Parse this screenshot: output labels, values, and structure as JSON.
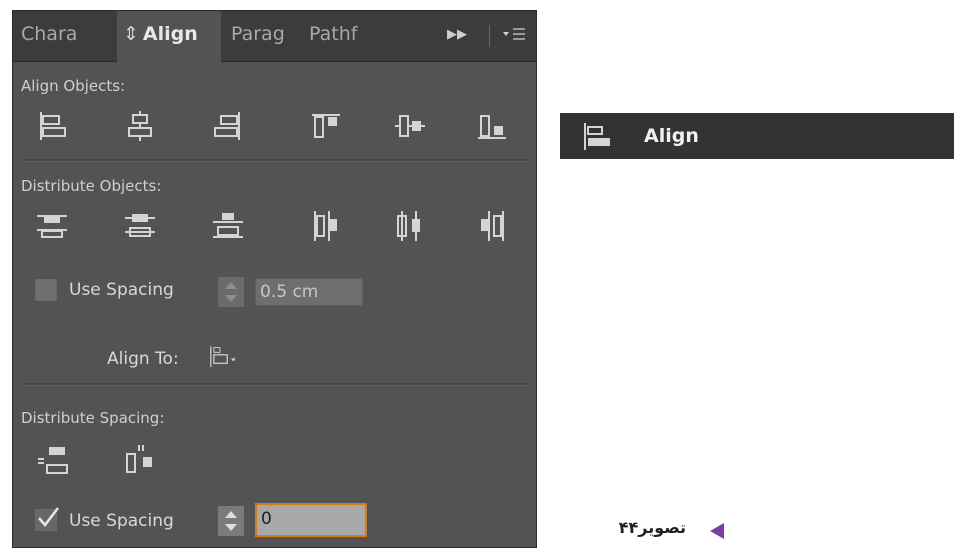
{
  "tabs": [
    {
      "label": "Chara"
    },
    {
      "label": "Align",
      "prefix": "⇕"
    },
    {
      "label": "Parag"
    },
    {
      "label": "Pathf"
    }
  ],
  "icons": {
    "more_tabs": "double-chevron-right-icon",
    "panel_menu": "panel-menu-icon",
    "stepper": "stepper-icon"
  },
  "align_objects": {
    "label": "Align Objects:",
    "buttons": [
      {
        "name": "horizontal-align-left"
      },
      {
        "name": "horizontal-align-center"
      },
      {
        "name": "horizontal-align-right"
      },
      {
        "name": "vertical-align-top"
      },
      {
        "name": "vertical-align-center"
      },
      {
        "name": "vertical-align-bottom"
      }
    ]
  },
  "distribute_objects": {
    "label": "Distribute Objects:",
    "buttons": [
      {
        "name": "vertical-distribute-top"
      },
      {
        "name": "vertical-distribute-center"
      },
      {
        "name": "vertical-distribute-bottom"
      },
      {
        "name": "horizontal-distribute-left"
      },
      {
        "name": "horizontal-distribute-center"
      },
      {
        "name": "horizontal-distribute-right"
      }
    ],
    "use_spacing_label": "Use Spacing",
    "use_spacing_checked": false,
    "spacing_value": "0.5 cm"
  },
  "align_to": {
    "label": "Align To:"
  },
  "distribute_spacing": {
    "label": "Distribute Spacing:",
    "buttons": [
      {
        "name": "vertical-distribute-space"
      },
      {
        "name": "horizontal-distribute-space"
      }
    ],
    "use_spacing_label": "Use Spacing",
    "use_spacing_checked": true,
    "spacing_value": "0"
  },
  "collapsed_panel": {
    "label": "Align"
  },
  "caption": {
    "text": "تصویر۴۴"
  },
  "colors": {
    "panel_bg": "#535353",
    "tabbar_bg": "#3c3c3c",
    "focus_border": "#d07a23",
    "caption_marker": "#7a3fa0"
  }
}
